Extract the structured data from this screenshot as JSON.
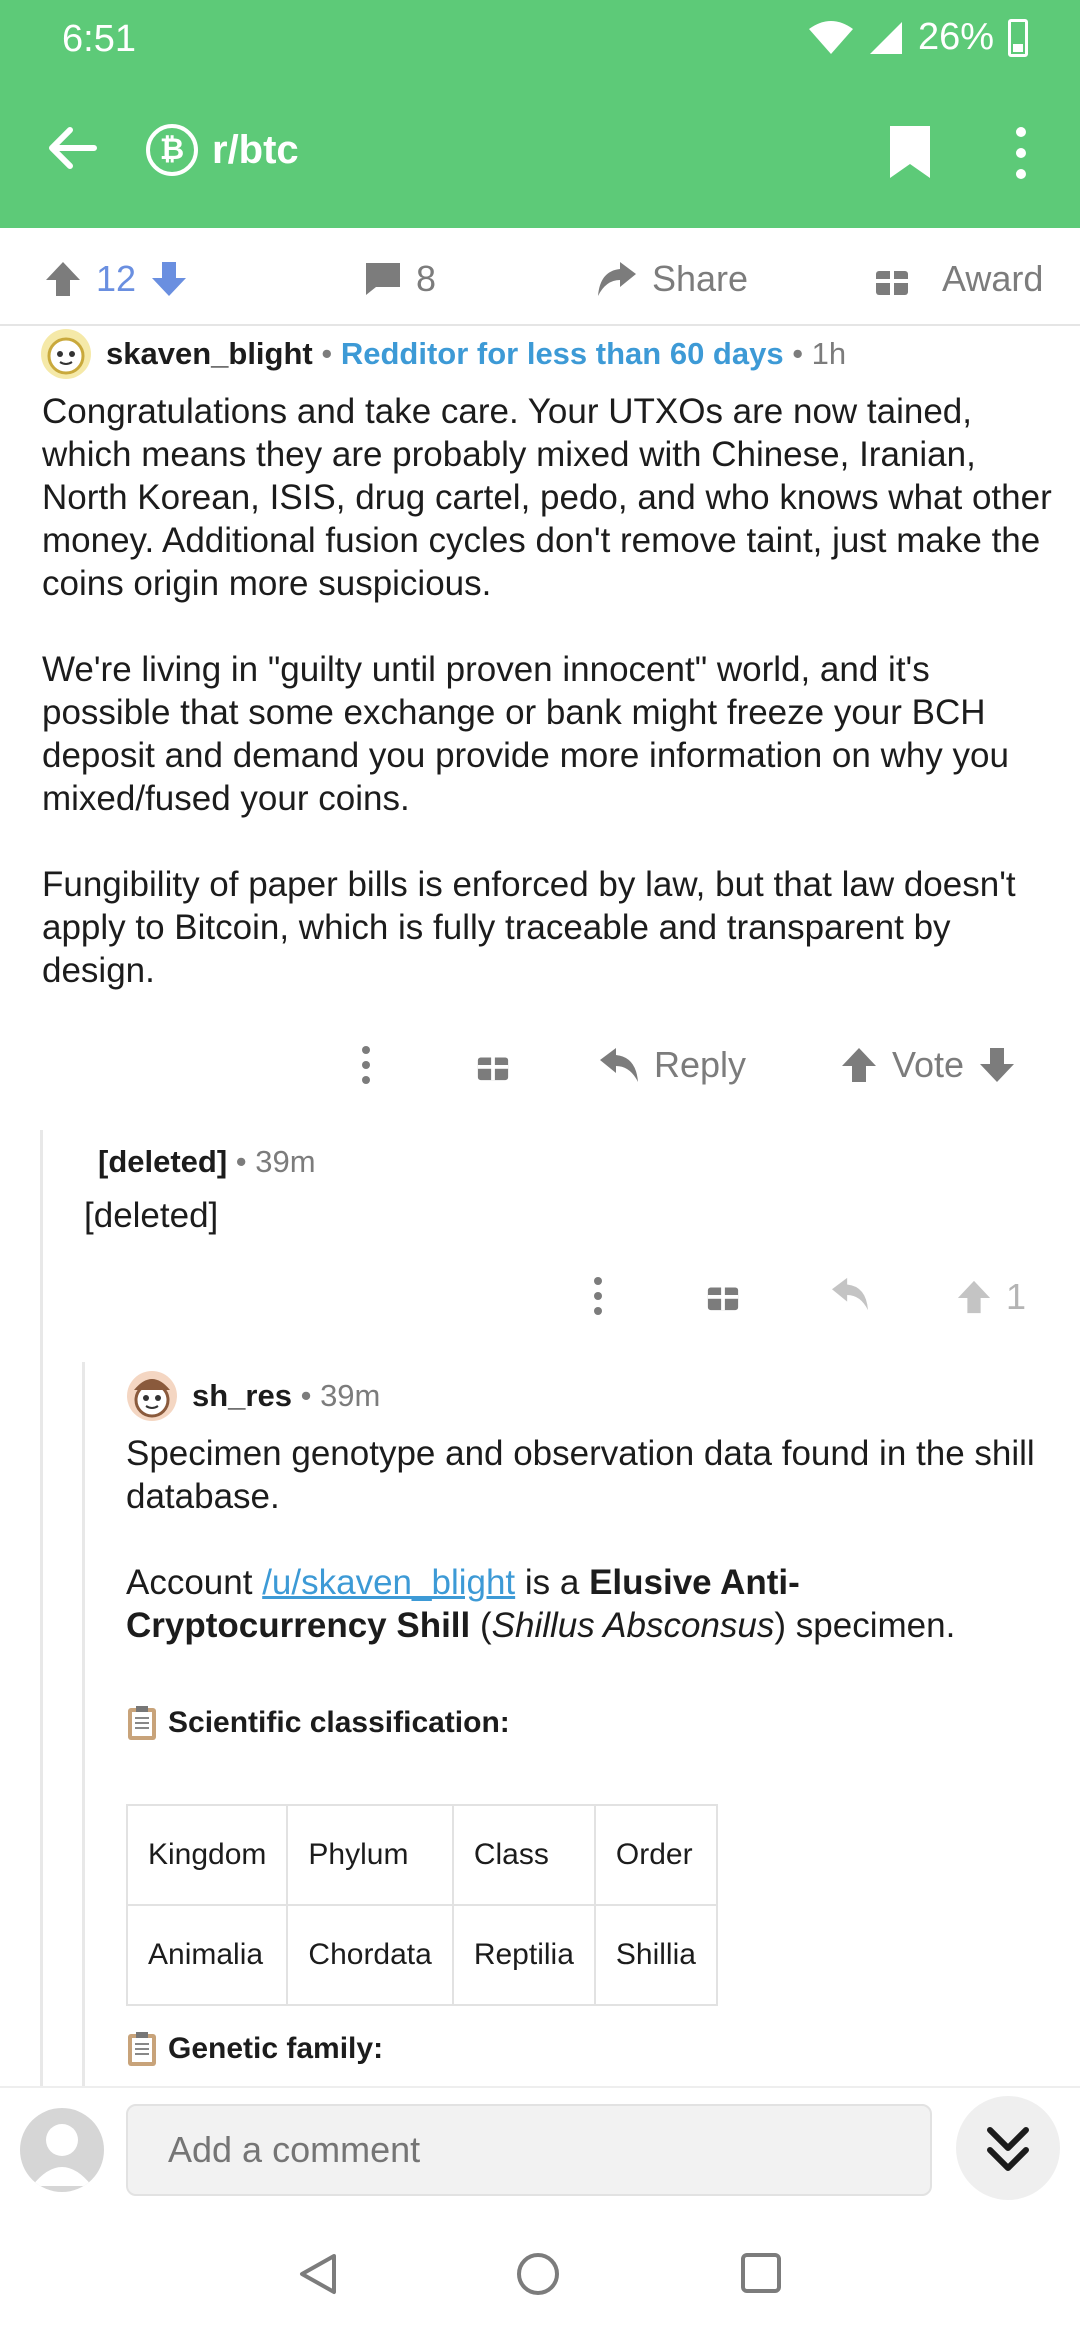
{
  "status_bar": {
    "time": "6:51",
    "battery": "26%"
  },
  "app_bar": {
    "subreddit": "r/btc",
    "sub_icon_letter": "₿"
  },
  "post_bar": {
    "votes": "12",
    "comments": "8",
    "share": "Share",
    "award": "Award"
  },
  "comments": [
    {
      "author": "skaven_blight",
      "flair": "Redditor for less than 60 days",
      "age": "1h",
      "paragraphs": [
        "Congratulations and take care. Your UTXOs are now tained, which means they are probably mixed with Chinese, Iranian, North Korean, ISIS, drug cartel, pedo, and who knows what other money. Additional fusion cycles don't remove taint, just make the coins origin more suspicious.",
        "We're living in \"guilty until proven innocent\" world, and it's possible that some exchange or bank might freeze your BCH deposit and demand you provide more information on why you mixed/fused your coins.",
        "Fungibility of paper bills is enforced by law, but that law doesn't apply to Bitcoin, which is fully traceable and transparent by design."
      ],
      "reply_label": "Reply",
      "vote_label": "Vote"
    },
    {
      "author": "[deleted]",
      "age": "39m",
      "body": "[deleted]",
      "score": "1"
    },
    {
      "author": "sh_res",
      "age": "39m",
      "p1": "Specimen genotype and observation data found in the shill database.",
      "p2_prefix": "Account ",
      "p2_link": "/u/skaven_blight",
      "p2_mid": " is a ",
      "p2_bold": "Elusive Anti-Cryptocurrency Shill",
      "p2_paren_open": " (",
      "p2_italic": "Shillus Absconsus",
      "p2_suffix": ") specimen.",
      "section1": "Scientific classification:",
      "table_headers": [
        "Kingdom",
        "Phylum",
        "Class",
        "Order"
      ],
      "table_values": [
        "Animalia",
        "Chordata",
        "Reptilia",
        "Shillia"
      ],
      "section2": "Genetic family:"
    }
  ],
  "comment_bar": {
    "placeholder": "Add a comment"
  },
  "colors": {
    "app_green": "#5dca78",
    "link_blue": "#3d9ad6",
    "upvote_blue": "#6a8fe0"
  }
}
